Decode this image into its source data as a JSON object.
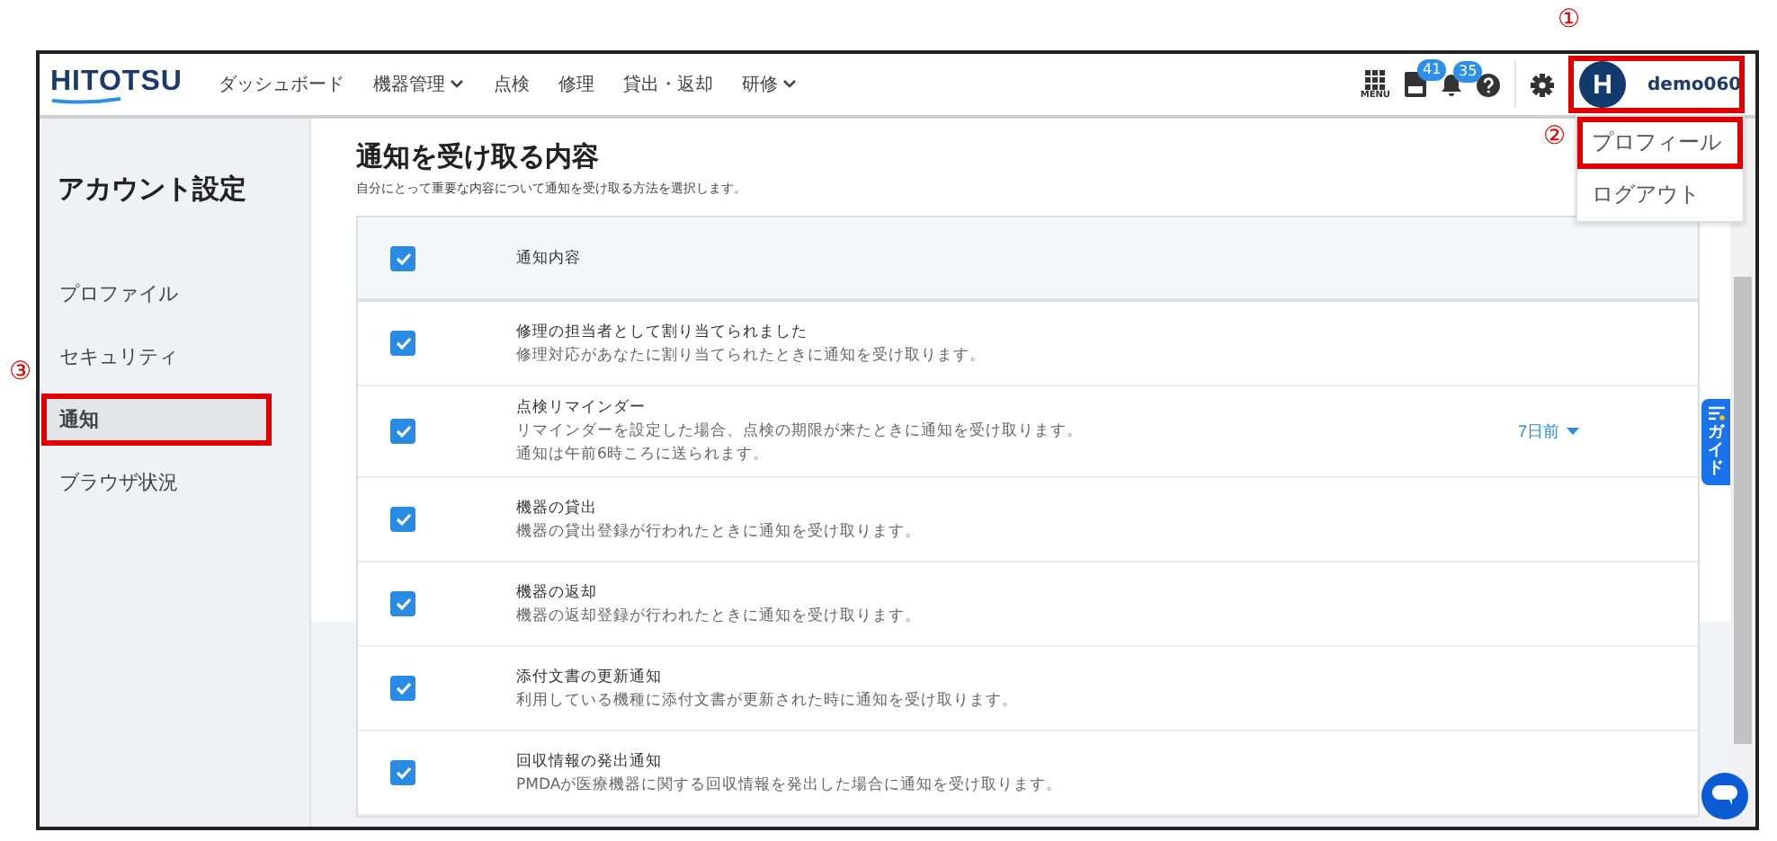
{
  "header": {
    "logo": "HITOTSU",
    "nav": [
      {
        "label": "ダッシュボード",
        "dropdown": false
      },
      {
        "label": "機器管理",
        "dropdown": true
      },
      {
        "label": "点検",
        "dropdown": false
      },
      {
        "label": "修理",
        "dropdown": false
      },
      {
        "label": "貸出・返却",
        "dropdown": false
      },
      {
        "label": "研修",
        "dropdown": true
      }
    ],
    "menu_label": "MENU",
    "pmda_badge": "41",
    "bell_badge": "35",
    "user": {
      "avatar": "H",
      "name": "demo060",
      "highlighted": true,
      "annotation": "①"
    }
  },
  "user_menu": [
    {
      "label": "プロフィール",
      "highlighted": true,
      "annotation": "②"
    },
    {
      "label": "ログアウト",
      "highlighted": false
    }
  ],
  "sidebar": {
    "title": "アカウント設定",
    "items": [
      {
        "label": "プロファイル",
        "selected": false,
        "highlighted": false
      },
      {
        "label": "セキュリティ",
        "selected": false,
        "highlighted": false
      },
      {
        "label": "通知",
        "selected": true,
        "highlighted": true,
        "annotation": "③"
      },
      {
        "label": "ブラウザ状況",
        "selected": false,
        "highlighted": false
      }
    ]
  },
  "main": {
    "title": "通知を受け取る内容",
    "subtitle": "自分にとって重要な内容について通知を受け取る方法を選択します。",
    "table": {
      "header": {
        "label": "通知内容",
        "checked": true
      },
      "rows": [
        {
          "title": "修理の担当者として割り当てられました",
          "lines": [
            "修理対応があなたに割り当てられたときに通知を受け取ります。"
          ],
          "checked": true
        },
        {
          "title": "点検リマインダー",
          "lines": [
            "リマインダーを設定した場合、点検の期限が来たときに通知を受け取ります。",
            "通知は午前6時ころに送られます。"
          ],
          "checked": true,
          "option": "7日前"
        },
        {
          "title": "機器の貸出",
          "lines": [
            "機器の貸出登録が行われたときに通知を受け取ります。"
          ],
          "checked": true
        },
        {
          "title": "機器の返却",
          "lines": [
            "機器の返却登録が行われたときに通知を受け取ります。"
          ],
          "checked": true
        },
        {
          "title": "添付文書の更新通知",
          "lines": [
            "利用している機種に添付文書が更新された時に通知を受け取ります。"
          ],
          "checked": true
        },
        {
          "title": "回収情報の発出通知",
          "lines": [
            "PMDAが医療機器に関する回収情報を発出した場合に通知を受け取ります。"
          ],
          "checked": true
        }
      ]
    }
  },
  "guide_tab": "ガイド"
}
